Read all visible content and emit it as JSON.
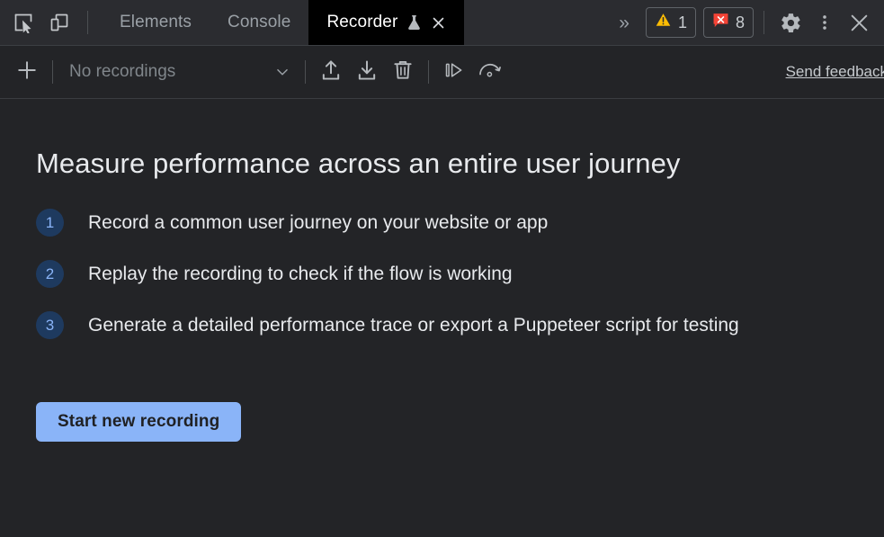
{
  "tabbar": {
    "inspect_icon": "inspect-element-icon",
    "device_icon": "device-toolbar-icon",
    "tabs": [
      {
        "label": "Elements",
        "active": false
      },
      {
        "label": "Console",
        "active": false
      },
      {
        "label": "Recorder",
        "active": true,
        "experimental_icon": "flask-icon",
        "close_icon": "close-icon"
      }
    ],
    "more_tabs_icon": "»",
    "warning_badge": {
      "icon": "warning-icon",
      "count": "1",
      "color": "#fbbc04"
    },
    "error_badge": {
      "icon": "error-icon",
      "count": "8",
      "color": "#f44336"
    },
    "settings_icon": "gear-icon",
    "more_options_icon": "three-dot-menu-icon",
    "close_icon": "close-devtools-icon"
  },
  "toolbar": {
    "add_icon": "plus-icon",
    "recordings_select": {
      "value": "No recordings",
      "caret_icon": "chevron-down-icon"
    },
    "import_icon": "import-icon",
    "export_icon": "export-icon",
    "delete_icon": "trash-icon",
    "replay_icon": "replay-icon",
    "performance_icon": "measure-performance-icon",
    "feedback_link": "Send feedback"
  },
  "main": {
    "headline": "Measure performance across an entire user journey",
    "steps": [
      {
        "num": "1",
        "text": "Record a common user journey on your website or app"
      },
      {
        "num": "2",
        "text": "Replay the recording to check if the flow is working"
      },
      {
        "num": "3",
        "text": "Generate a detailed performance trace or export a Puppeteer script for testing"
      }
    ],
    "start_button": "Start new recording"
  },
  "colors": {
    "accent": "#8ab4f8",
    "background": "#232427",
    "tabbar_background": "#2b2c30",
    "active_tab_background": "#000000",
    "text": "#e8eaed",
    "muted_text": "#9aa0a6",
    "warning": "#fbbc04",
    "error": "#f44336",
    "step_badge_background": "#1e3a5f"
  }
}
